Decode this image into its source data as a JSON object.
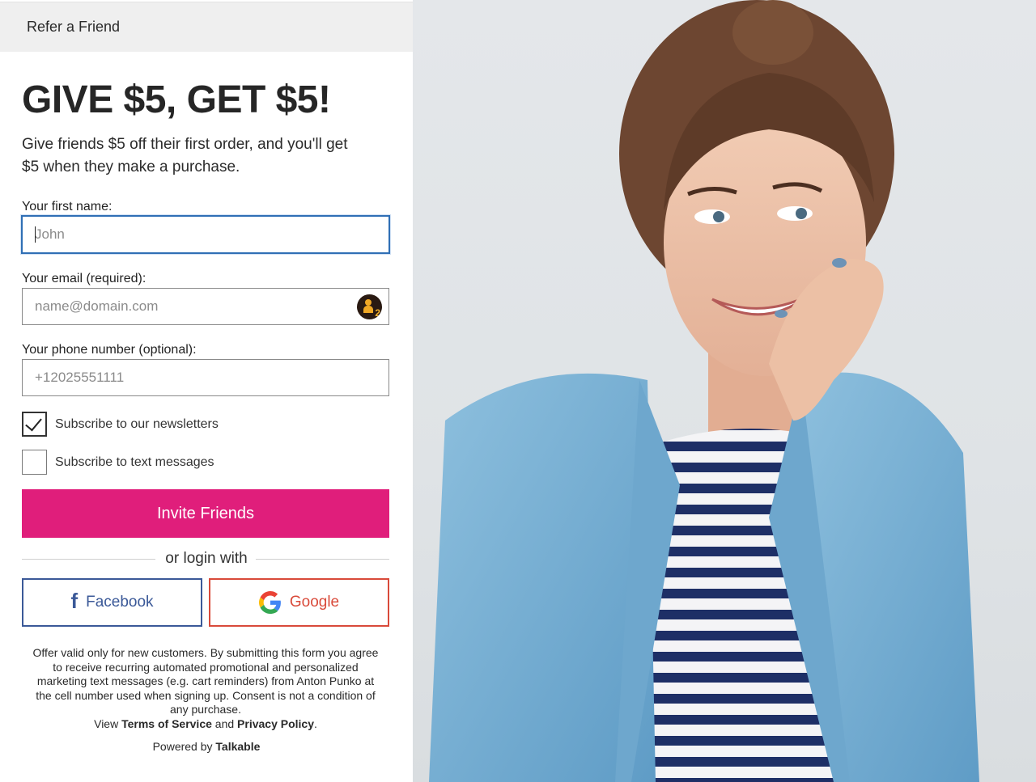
{
  "header": {
    "title": "Refer a Friend"
  },
  "hero": {
    "headline": "GIVE $5, GET $5!",
    "subtitle": "Give friends $5 off their first order, and you'll get $5 when they make a purchase."
  },
  "form": {
    "first_name": {
      "label": "Your first name:",
      "placeholder": "John",
      "value": ""
    },
    "email": {
      "label": "Your email (required):",
      "placeholder": "name@domain.com",
      "value": "",
      "badge_count": "2"
    },
    "phone": {
      "label": "Your phone number (optional):",
      "placeholder": "+12025551111",
      "value": ""
    },
    "newsletter": {
      "label": "Subscribe to our newsletters",
      "checked": true
    },
    "texts": {
      "label": "Subscribe to text messages",
      "checked": false
    },
    "submit_label": "Invite Friends"
  },
  "login": {
    "divider_text": "or login with",
    "facebook_label": "Facebook",
    "google_label": "Google"
  },
  "legal": {
    "text": "Offer valid only for new customers. By submitting this form you agree to receive recurring automated promotional and personalized marketing text messages (e.g. cart reminders) from Anton Punko at the cell number used when signing up. Consent is not a condition of any purchase.",
    "view": "View",
    "terms": "Terms of Service",
    "and": "and",
    "privacy": "Privacy Policy",
    "period": "."
  },
  "footer": {
    "powered_by": "Powered by",
    "brand": "Talkable"
  },
  "colors": {
    "primary": "#e01e7b",
    "facebook": "#3b5998",
    "google": "#d94a3a",
    "focus": "#2f6fb5"
  }
}
